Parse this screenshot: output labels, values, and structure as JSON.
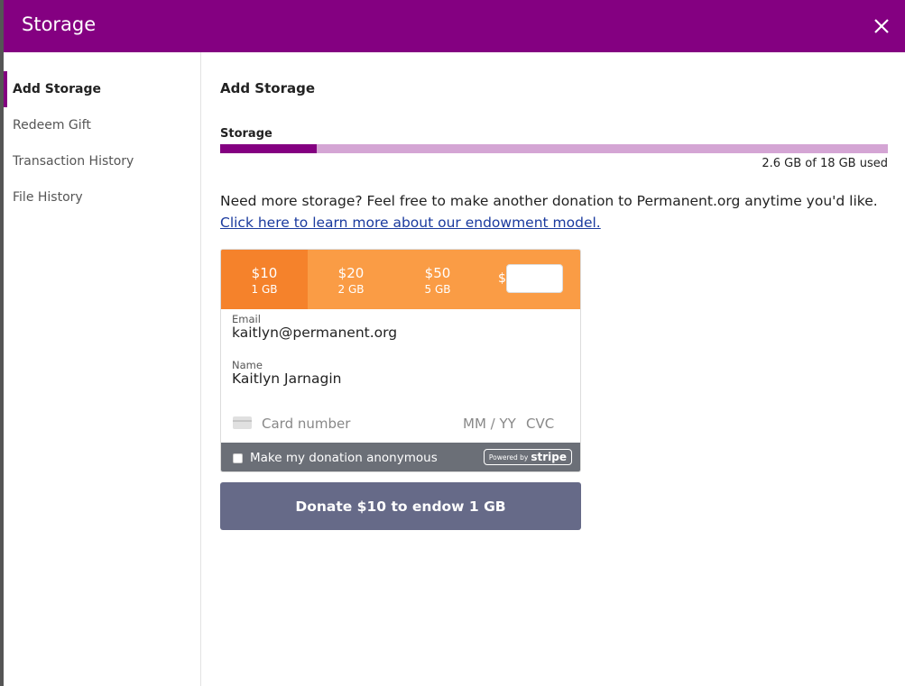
{
  "modal": {
    "title": "Storage"
  },
  "sidebar": {
    "items": [
      {
        "label": "Add Storage",
        "active": true
      },
      {
        "label": "Redeem Gift",
        "active": false
      },
      {
        "label": "Transaction History",
        "active": false
      },
      {
        "label": "File History",
        "active": false
      }
    ]
  },
  "storage": {
    "section_title": "Add Storage",
    "label": "Storage",
    "used_fraction": 0.144,
    "usage_text": "2.6 GB of 18 GB used",
    "info_text": "Need more storage? Feel free to make another donation to Permanent.org anytime you'd like.",
    "link_text": "Click here to learn more about our endowment model."
  },
  "donation": {
    "amounts": [
      {
        "price": "$10",
        "size": "1 GB",
        "selected": true
      },
      {
        "price": "$20",
        "size": "2 GB",
        "selected": false
      },
      {
        "price": "$50",
        "size": "5 GB",
        "selected": false
      }
    ],
    "custom_prefix": "$",
    "email_label": "Email",
    "email_value": "kaitlyn@permanent.org",
    "name_label": "Name",
    "name_value": "Kaitlyn Jarnagin",
    "card_number_placeholder": "Card number",
    "expiry_placeholder": "MM / YY",
    "cvc_placeholder": "CVC",
    "anonymous_label": "Make my donation anonymous",
    "powered_by": "Powered by",
    "stripe": "stripe",
    "button_label": "Donate $10 to endow 1 GB"
  },
  "colors": {
    "brand": "#840081",
    "storage_track": "#d4a5d4",
    "amount_bg": "#fa9c45",
    "amount_selected": "#f5822b",
    "donate_button": "#666a88"
  }
}
